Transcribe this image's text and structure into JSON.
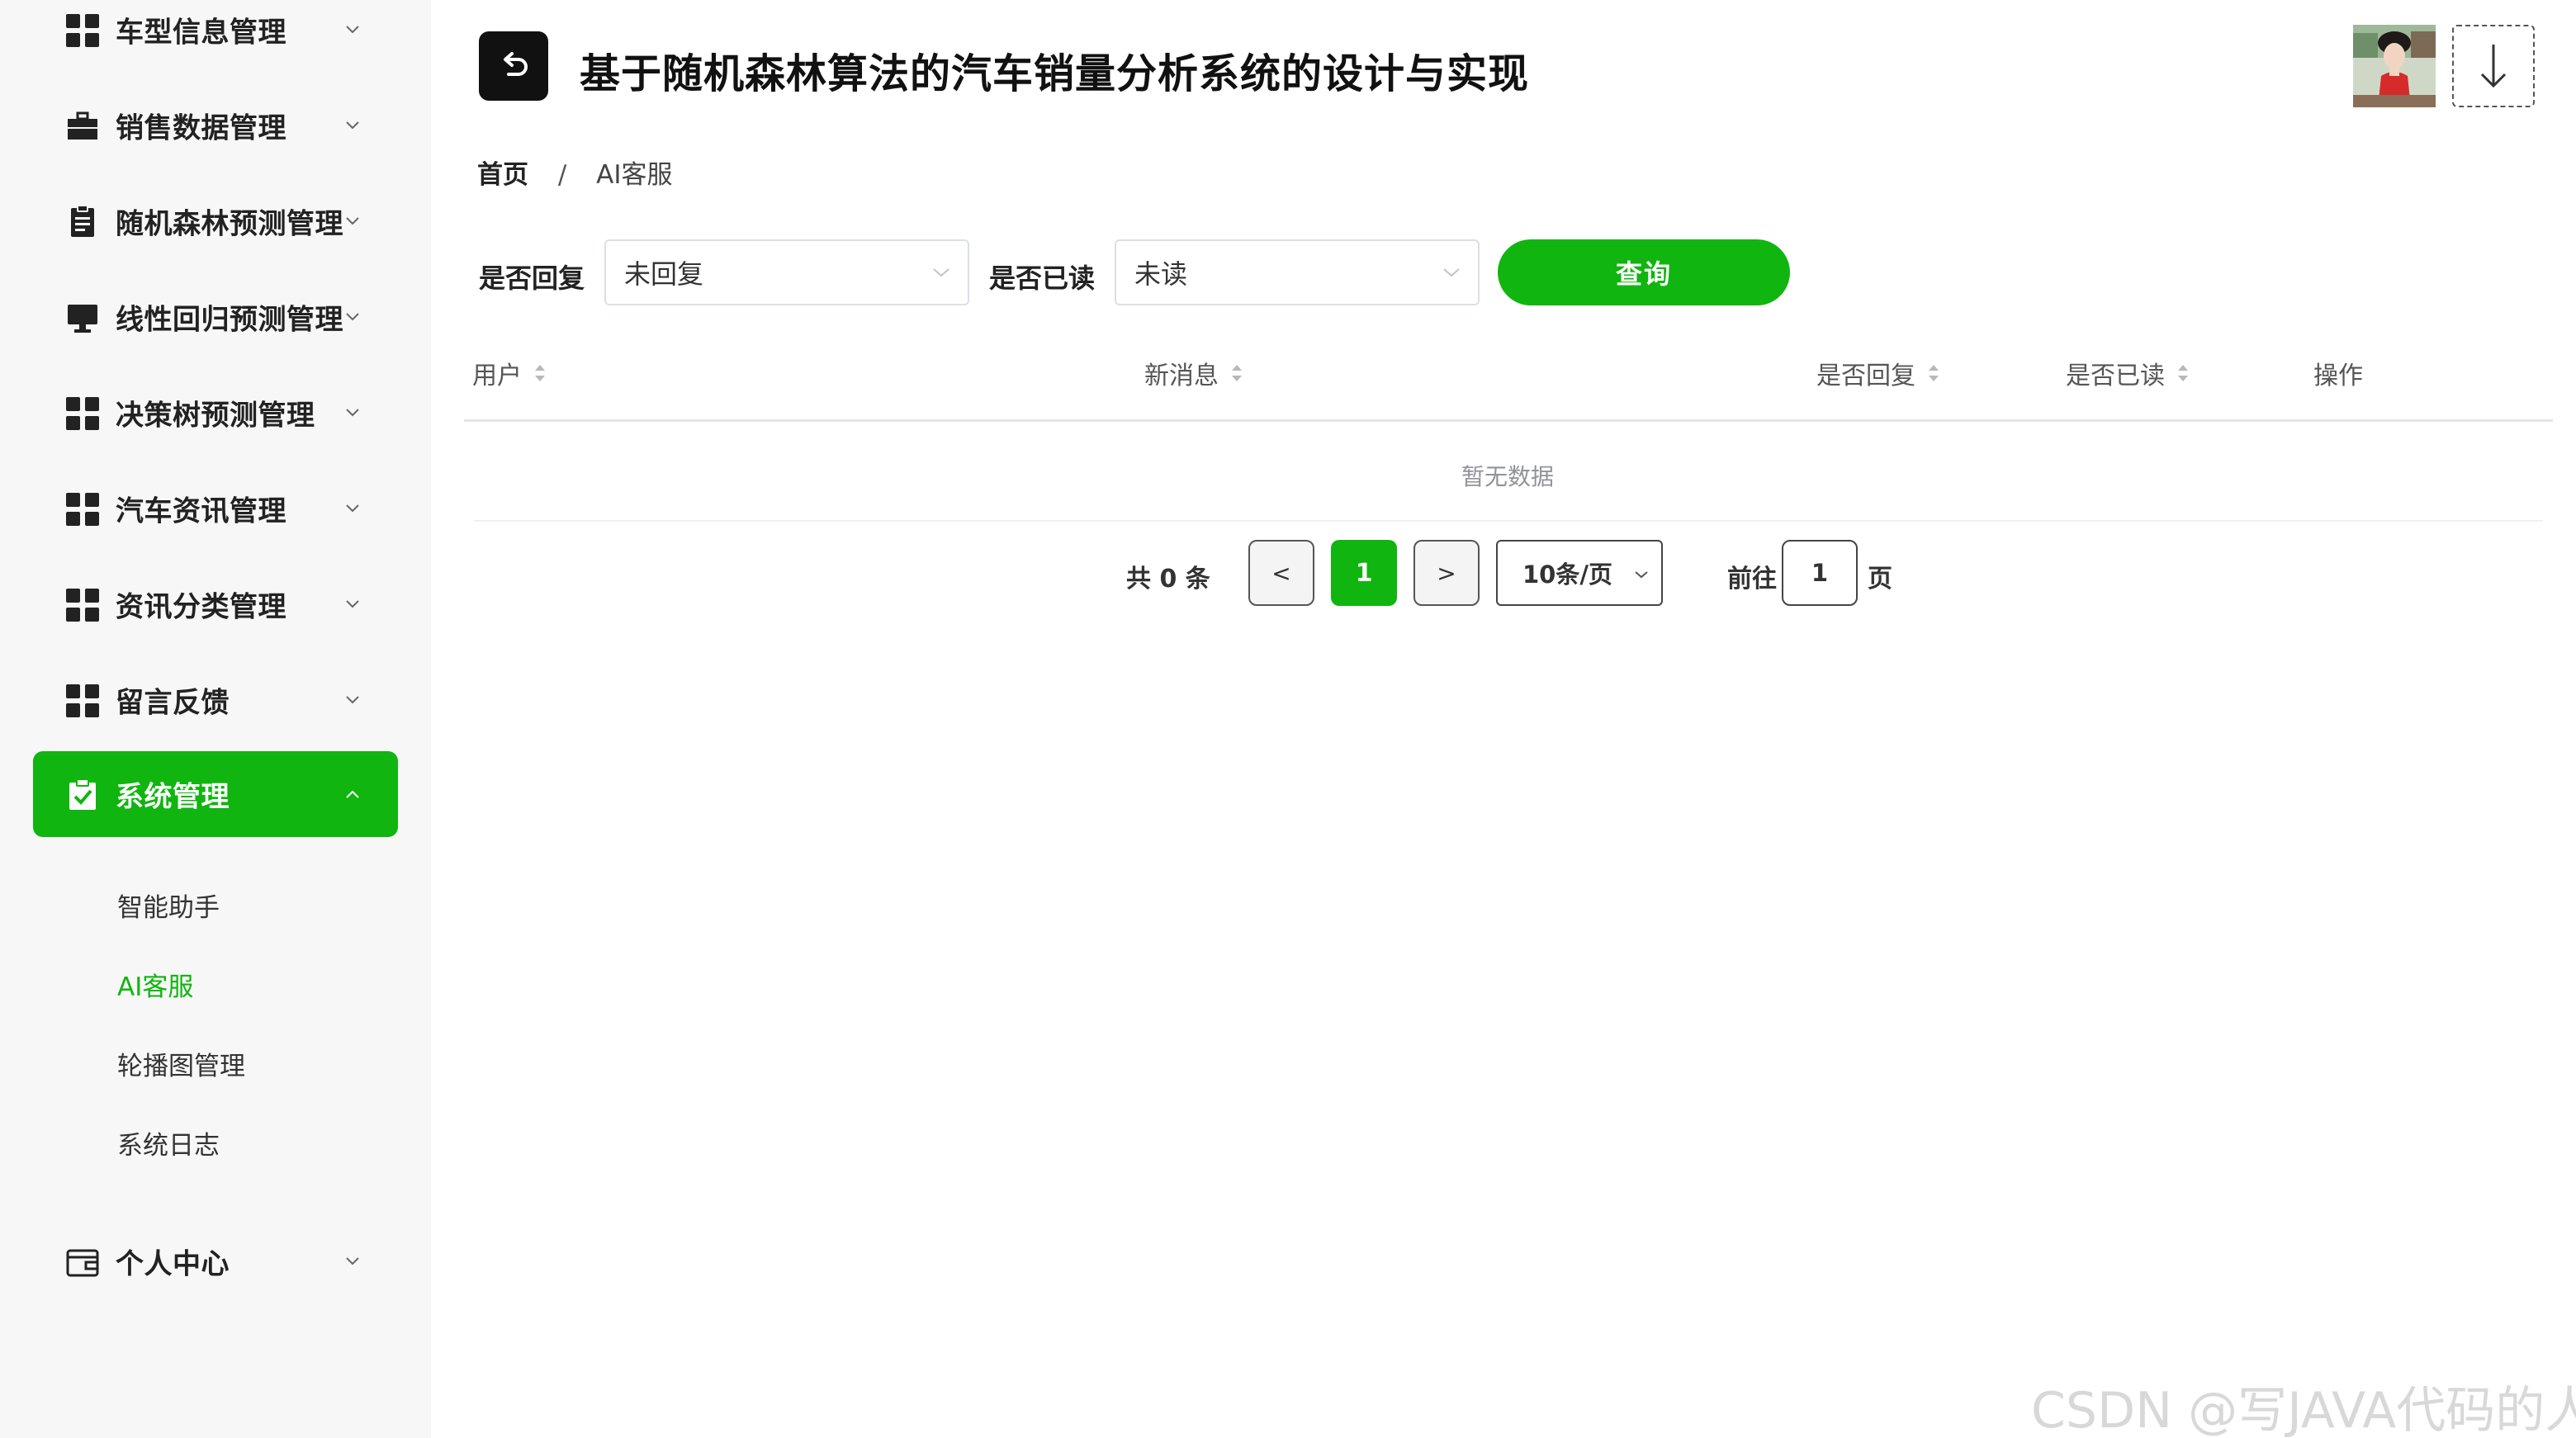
{
  "header": {
    "title": "基于随机森林算法的汽车销量分析系统的设计与实现"
  },
  "breadcrumb": {
    "home": "首页",
    "separator": "/",
    "current": "AI客服"
  },
  "sidebar": {
    "items": [
      {
        "label": "车型信息管理",
        "icon": "grid-icon"
      },
      {
        "label": "销售数据管理",
        "icon": "briefcase-icon"
      },
      {
        "label": "随机森林预测管理",
        "icon": "document-icon"
      },
      {
        "label": "线性回归预测管理",
        "icon": "monitor-icon"
      },
      {
        "label": "决策树预测管理",
        "icon": "grid-icon"
      },
      {
        "label": "汽车资讯管理",
        "icon": "grid-icon"
      },
      {
        "label": "资讯分类管理",
        "icon": "grid-icon"
      },
      {
        "label": "留言反馈",
        "icon": "grid-icon"
      },
      {
        "label": "系统管理",
        "icon": "clipboard-check-icon",
        "active": true
      }
    ],
    "sub_items": [
      "智能助手",
      "AI客服",
      "轮播图管理",
      "系统日志"
    ],
    "active_sub": "AI客服",
    "personal": {
      "label": "个人中心",
      "icon": "wallet-icon"
    }
  },
  "filters": {
    "replied_label": "是否回复",
    "replied_value": "未回复",
    "read_label": "是否已读",
    "read_value": "未读",
    "query_button": "查询"
  },
  "table": {
    "columns": [
      "用户",
      "新消息",
      "是否回复",
      "是否已读",
      "操作"
    ],
    "empty_text": "暂无数据"
  },
  "pagination": {
    "total_text": "共 0 条",
    "prev": "<",
    "current_page": "1",
    "next": ">",
    "page_size": "10条/页",
    "goto_label": "前往",
    "goto_value": "1",
    "goto_suffix": "页"
  },
  "watermark": "CSDN @写JAVA代码的人",
  "colors": {
    "accent": "#10b510",
    "sidebar_bg": "#f7f7f7"
  }
}
